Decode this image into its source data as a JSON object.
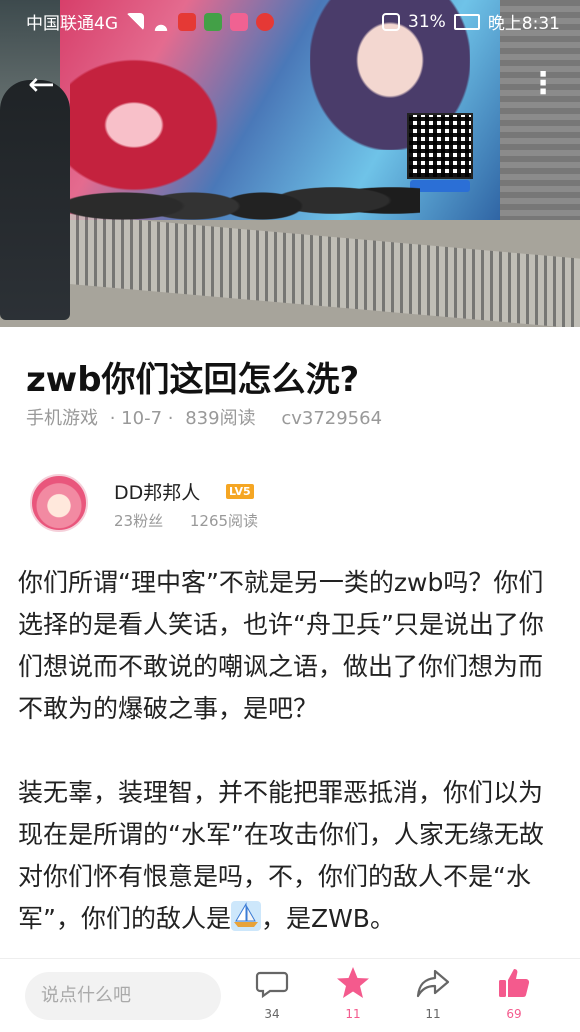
{
  "statusbar": {
    "carrier": "中国联通4G",
    "battery": "31%",
    "time": "晚上8:31"
  },
  "hero": {
    "qr_caption": "游戏官网"
  },
  "article": {
    "title": "zwb你们这回怎么洗?",
    "category": "手机游戏",
    "date": "· 10-7 ·",
    "reads": "839阅读",
    "cv": "cv3729564"
  },
  "author": {
    "name": "DD邦邦人",
    "level": "LV5",
    "fans": "23粉丝",
    "reads": "1265阅读"
  },
  "body": {
    "p1": "你们所谓“理中客”不就是另一类的zwb吗？你们选择的是看人笑话，也许“舟卫兵”只是说出了你们想说而不敢说的嘲讽之语，做出了你们想为而不敢为的爆破之事，是吧？",
    "p2_before": "装无辜，装理智，并不能把罪恶抵消，你们以为现在是所谓的“水军”在攻击你们，人家无缘无故对你们怀有恨意是吗，不，你们的敌人不是“水军”，你们的敌人是",
    "p2_after": "，是ZWB。"
  },
  "bottombar": {
    "placeholder": "说点什么吧",
    "comments": "34",
    "favorites": "11",
    "shares": "11",
    "likes": "69"
  },
  "colors": {
    "accent": "#f45a8d",
    "level_badge": "#f5a623"
  }
}
